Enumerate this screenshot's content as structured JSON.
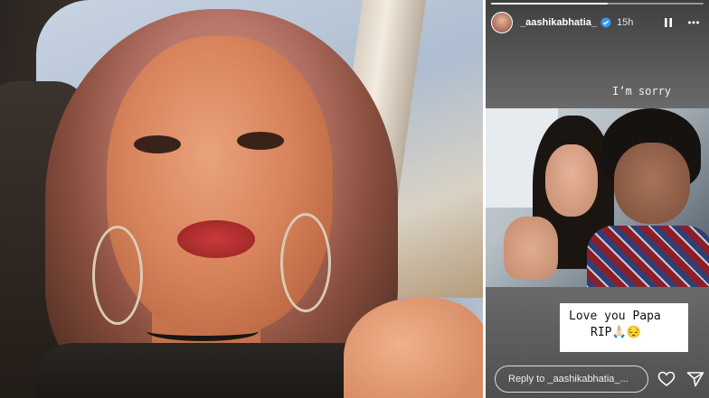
{
  "story": {
    "username": "_aashikabhatia_",
    "time": "15h",
    "text_top": "I’m sorry",
    "caption_line1": "Love you Papa",
    "caption_line2": "RIP🙏🏻😔",
    "reply_placeholder": "Reply to _aashikabhatia_...",
    "progress_fraction": 0.55
  },
  "icons": {
    "verified": "verified-badge-icon",
    "pause": "pause-icon",
    "more": "more-options-icon",
    "heart": "heart-icon",
    "send": "send-icon"
  },
  "colors": {
    "panel_bg": "#5a5a5a",
    "text_light": "#ffffff",
    "verified": "#3897f0"
  }
}
